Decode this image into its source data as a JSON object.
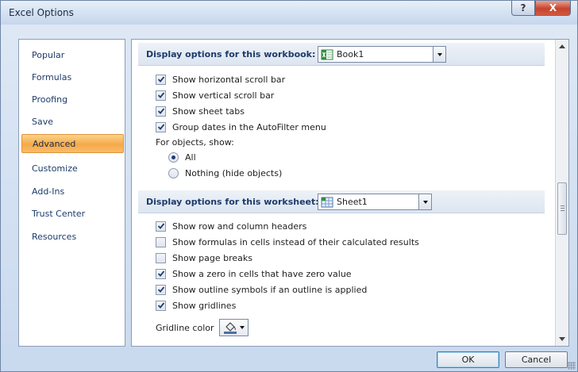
{
  "window": {
    "title": "Excel Options",
    "help_label": "?",
    "close_label": "X"
  },
  "sidebar": {
    "items": [
      {
        "label": "Popular"
      },
      {
        "label": "Formulas"
      },
      {
        "label": "Proofing"
      },
      {
        "label": "Save"
      },
      {
        "label": "Advanced",
        "active": true
      },
      {
        "label": "Customize"
      },
      {
        "label": "Add-Ins"
      },
      {
        "label": "Trust Center"
      },
      {
        "label": "Resources"
      }
    ]
  },
  "workbook_section": {
    "title": "Display options for this workbook:",
    "selected": "Book1",
    "options": [
      {
        "label": "Show horizontal scroll bar",
        "checked": true
      },
      {
        "label": "Show vertical scroll bar",
        "checked": true
      },
      {
        "label": "Show sheet tabs",
        "checked": true
      },
      {
        "label": "Group dates in the AutoFilter menu",
        "checked": true
      }
    ],
    "objects_label": "For objects, show:",
    "objects_options": [
      {
        "label": "All",
        "selected": true
      },
      {
        "label": "Nothing (hide objects)",
        "selected": false
      }
    ]
  },
  "worksheet_section": {
    "title": "Display options for this worksheet:",
    "selected": "Sheet1",
    "options": [
      {
        "label": "Show row and column headers",
        "checked": true
      },
      {
        "label": "Show formulas in cells instead of their calculated results",
        "checked": false
      },
      {
        "label": "Show page breaks",
        "checked": false
      },
      {
        "label": "Show a zero in cells that have zero value",
        "checked": true
      },
      {
        "label": "Show outline symbols if an outline is applied",
        "checked": true
      },
      {
        "label": "Show gridlines",
        "checked": true
      }
    ],
    "gridline_color_label": "Gridline color"
  },
  "footer": {
    "ok_label": "OK",
    "cancel_label": "Cancel"
  },
  "colors": {
    "accent_active": "#f6a94a",
    "header_text": "#1d3b6a",
    "check": "#1f3d70"
  }
}
